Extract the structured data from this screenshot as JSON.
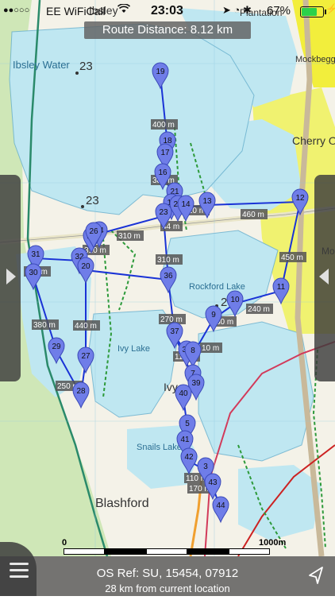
{
  "status_bar": {
    "signal_dots": "●●○○○",
    "carrier": "EE WiFiCall",
    "wifi_icon": "wifi-icon",
    "time": "23:03",
    "status_icons": "➤ ◔ ✱",
    "battery_percent": "67%",
    "battery_level": 0.67,
    "charging_icon": "⚡"
  },
  "route": {
    "distance_label": "Route Distance: 8.12 km",
    "line_color": "#1a33d6",
    "pin_color": "#6f7de8",
    "waypoints": [
      "19",
      "18",
      "17",
      "16",
      "21",
      "15",
      "23",
      "22",
      "14",
      "13",
      "12",
      "24",
      "25",
      "26",
      "32",
      "31",
      "30",
      "20",
      "36",
      "37",
      "27",
      "29",
      "28",
      "9",
      "10",
      "11",
      "38",
      "8",
      "7",
      "39",
      "40",
      "5",
      "41",
      "42",
      "3",
      "43",
      "44"
    ],
    "segment_labels": [
      "380 m",
      "400 m",
      "310 m",
      "110 m",
      "460 m",
      "310 m",
      "44 m",
      "210 m",
      "450 m",
      "310 m",
      "270 m",
      "240 m",
      "30 m",
      "110 m",
      "440 m",
      "380 m",
      "250 m",
      "110 m",
      "10 m",
      "170 m"
    ]
  },
  "map": {
    "places": [
      "Ibsley",
      "Ibsley Water",
      "23",
      "23",
      "Mockbeggar",
      "Cherry O",
      "Rockford Lake",
      "2",
      "Ivy Lake",
      "Ivy",
      "Snails Lake",
      "Blashford",
      "Plantation",
      "Mo"
    ],
    "water_color": "#bfe8f2",
    "land_color": "#f6f4ec"
  },
  "scale_bar": {
    "start_label": "0",
    "end_label": "1000m"
  },
  "footer": {
    "os_ref": "OS Ref: SU, 15454, 07912",
    "distance_from": "28 km from current location",
    "menu_icon": "hamburger-menu-icon",
    "locate_icon": "navigation-arrow-icon"
  },
  "side_panels": {
    "left_arrow": "chevron-right-icon",
    "right_arrow": "chevron-left-icon"
  }
}
